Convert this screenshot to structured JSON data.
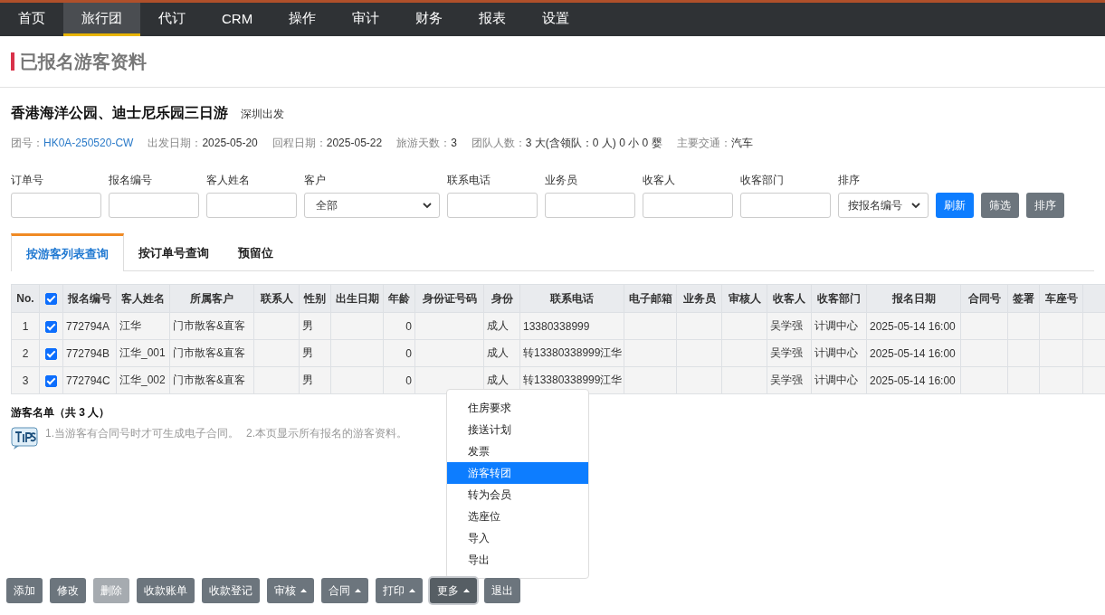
{
  "nav": [
    {
      "label": "首页",
      "selected": false
    },
    {
      "label": "旅行团",
      "selected": true
    },
    {
      "label": "代订",
      "selected": false
    },
    {
      "label": "CRM",
      "selected": false
    },
    {
      "label": "操作",
      "selected": false
    },
    {
      "label": "审计",
      "selected": false
    },
    {
      "label": "财务",
      "selected": false
    },
    {
      "label": "报表",
      "selected": false
    },
    {
      "label": "设置",
      "selected": false
    }
  ],
  "page_title": "已报名游客资料",
  "tour": {
    "name": "香港海洋公园、迪士尼乐园三日游",
    "departure": "深圳出发",
    "info": [
      {
        "label": "团号：",
        "value": "HK0A-250520-CW",
        "link": true
      },
      {
        "label": "出发日期：",
        "value": "2025-05-20",
        "link": false
      },
      {
        "label": "回程日期：",
        "value": "2025-05-22",
        "link": false
      },
      {
        "label": "旅游天数：",
        "value": "3",
        "link": false
      },
      {
        "label": "团队人数：",
        "value": "3 大(含领队：0 人) 0 小 0 婴",
        "link": false
      },
      {
        "label": "主要交通：",
        "value": "汽车",
        "link": false
      }
    ]
  },
  "filters": [
    {
      "label": "订单号",
      "kind": "text"
    },
    {
      "label": "报名编号",
      "kind": "text"
    },
    {
      "label": "客人姓名",
      "kind": "text"
    },
    {
      "label": "客户",
      "kind": "select",
      "value": "全部"
    },
    {
      "label": "联系电话",
      "kind": "text"
    },
    {
      "label": "业务员",
      "kind": "text"
    },
    {
      "label": "收客人",
      "kind": "text"
    },
    {
      "label": "收客部门",
      "kind": "text"
    },
    {
      "label": "排序",
      "kind": "select",
      "value": "按报名编号"
    }
  ],
  "filter_buttons": [
    {
      "label": "刷新",
      "kind": "primary"
    },
    {
      "label": "筛选",
      "kind": "secondary"
    },
    {
      "label": "排序",
      "kind": "secondary"
    }
  ],
  "tabs": [
    {
      "label": "按游客列表查询",
      "selected": true
    },
    {
      "label": "按订单号查询",
      "selected": false
    },
    {
      "label": "预留位",
      "selected": false
    }
  ],
  "table": {
    "header_checked": true,
    "columns": [
      "No.",
      "报名编号",
      "客人姓名",
      "所属客户",
      "联系人",
      "性别",
      "出生日期",
      "年龄",
      "身份证号码",
      "身份",
      "联系电话",
      "电子邮箱",
      "业务员",
      "审核人",
      "收客人",
      "收客部门",
      "报名日期",
      "合同号",
      "签署",
      "车座号"
    ],
    "rows": [
      {
        "checked": true,
        "cells": [
          "1",
          "772794A",
          "江华",
          "门市散客&直客",
          "",
          "男",
          "",
          "0",
          "",
          "成人",
          "13380338999",
          "",
          "",
          "",
          "吴学强",
          "计调中心",
          "2025-05-14 16:00",
          "",
          "",
          ""
        ]
      },
      {
        "checked": true,
        "cells": [
          "2",
          "772794B",
          "江华_001",
          "门市散客&直客",
          "",
          "男",
          "",
          "0",
          "",
          "成人",
          "转13380338999江华",
          "",
          "",
          "",
          "吴学强",
          "计调中心",
          "2025-05-14 16:00",
          "",
          "",
          ""
        ]
      },
      {
        "checked": true,
        "cells": [
          "3",
          "772794C",
          "江华_002",
          "门市散客&直客",
          "",
          "男",
          "",
          "0",
          "",
          "成人",
          "转13380338999江华",
          "",
          "",
          "",
          "吴学强",
          "计调中心",
          "2025-05-14 16:00",
          "",
          "",
          ""
        ]
      }
    ]
  },
  "summary": "游客名单（共 3 人）",
  "tips": [
    "1.当游客有合同号时才可生成电子合同。",
    "2.本页显示所有报名的游客资料。"
  ],
  "more_menu": [
    {
      "label": "住房要求",
      "selected": false
    },
    {
      "label": "接送计划",
      "selected": false
    },
    {
      "label": "发票",
      "selected": false
    },
    {
      "label": "游客转团",
      "selected": true
    },
    {
      "label": "转为会员",
      "selected": false
    },
    {
      "label": "选座位",
      "selected": false
    },
    {
      "label": "导入",
      "selected": false
    },
    {
      "label": "导出",
      "selected": false
    }
  ],
  "buttons": [
    {
      "label": "添加",
      "kind": "plain",
      "disabled": false,
      "pressed": false
    },
    {
      "label": "修改",
      "kind": "plain",
      "disabled": false,
      "pressed": false
    },
    {
      "label": "删除",
      "kind": "plain",
      "disabled": true,
      "pressed": false
    },
    {
      "label": "收款账单",
      "kind": "plain",
      "disabled": false,
      "pressed": false
    },
    {
      "label": "收款登记",
      "kind": "plain",
      "disabled": false,
      "pressed": false
    },
    {
      "label": "审核",
      "kind": "dropdown",
      "disabled": false,
      "pressed": false
    },
    {
      "label": "合同",
      "kind": "dropdown",
      "disabled": false,
      "pressed": false
    },
    {
      "label": "打印",
      "kind": "dropdown",
      "disabled": false,
      "pressed": false
    },
    {
      "label": "更多",
      "kind": "dropdown",
      "disabled": false,
      "pressed": true
    },
    {
      "label": "退出",
      "kind": "plain",
      "disabled": false,
      "pressed": false
    }
  ]
}
